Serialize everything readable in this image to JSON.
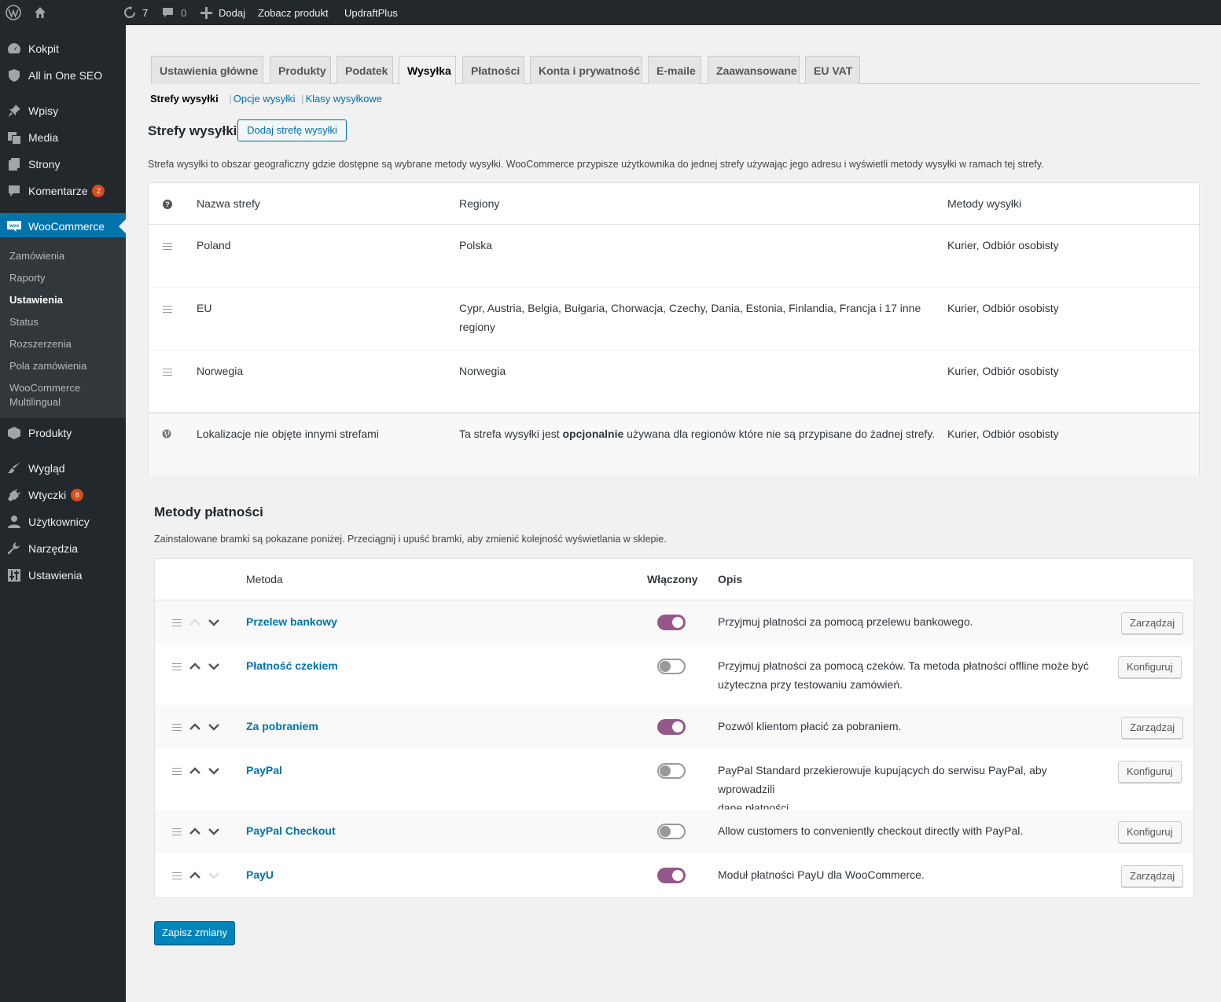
{
  "adminbar": {
    "updates_count": "7",
    "comments_count": "0",
    "new_label": "Dodaj",
    "view_product": "Zobacz produkt",
    "updraft": "UpdraftPlus"
  },
  "sidebar": {
    "dashboard": "Kokpit",
    "seo": "All in One SEO",
    "posts": "Wpisy",
    "media": "Media",
    "pages": "Strony",
    "comments": "Komentarze",
    "comments_badge": "2",
    "woocommerce": "WooCommerce",
    "submenu": [
      "Zamówienia",
      "Raporty",
      "Ustawienia",
      "Status",
      "Rozszerzenia",
      "Pola zamówienia",
      "WooCommerce Multilingual"
    ],
    "products": "Produkty",
    "appearance": "Wygląd",
    "plugins": "Wtyczki",
    "plugins_badge": "8",
    "users": "Użytkownicy",
    "tools": "Narzędzia",
    "settings": "Ustawienia"
  },
  "tabs": [
    "Ustawienia główne",
    "Produkty",
    "Podatek",
    "Wysyłka",
    "Płatności",
    "Konta i prywatność",
    "E-maile",
    "Zaawansowane",
    "EU VAT"
  ],
  "subnav": {
    "zones": "Strefy wysyłki",
    "sep": "|",
    "options": "Opcje wysyłki",
    "classes": "Klasy wysyłkowe"
  },
  "zones": {
    "title": "Strefy wysyłki",
    "add_button": "Dodaj strefę wysyłki",
    "description": "Strefa wysyłki to obszar geograficzny gdzie dostępne są wybrane metody wysyłki. WooCommerce przypisze użytkownika do jednej strefy używając jego adresu i wyświetli metody wysyłki w ramach tej strefy.",
    "headers": {
      "name": "Nazwa strefy",
      "regions": "Regiony",
      "methods": "Metody wysyłki"
    },
    "rows": [
      {
        "name": "Poland",
        "regions": "Polska",
        "methods": "Kurier, Odbiór osobisty"
      },
      {
        "name": "EU",
        "regions_line1": "Cypr, Austria, Belgia, Bułgaria, Chorwacja, Czechy, Dania, Estonia, Finlandia, Francja i 17 inne",
        "regions_line2": "regiony",
        "methods": "Kurier, Odbiór osobisty"
      },
      {
        "name": "Norwegia",
        "regions": "Norwegia",
        "methods": "Kurier, Odbiór osobisty"
      }
    ],
    "rest": {
      "name": "Lokalizacje nie objęte innymi strefami",
      "desc_before": "Ta strefa wysyłki jest ",
      "desc_bold": "opcjonalnie",
      "desc_after": " używana dla regionów które nie są przypisane do żadnej strefy.",
      "methods": "Kurier, Odbiór osobisty"
    }
  },
  "payments": {
    "title": "Metody płatności",
    "description": "Zainstalowane bramki są pokazane poniżej. Przeciągnij i upuść bramki, aby zmienić kolejność wyświetlania w sklepie.",
    "headers": {
      "method": "Metoda",
      "enabled": "Włączony",
      "desc": "Opis"
    },
    "rows": [
      {
        "name": "Przelew bankowy",
        "enabled": true,
        "desc1": "Przyjmuj płatności za pomocą przelewu bankowego.",
        "desc2": "",
        "button": "Zarządzaj"
      },
      {
        "name": "Płatność czekiem",
        "enabled": false,
        "desc1": "Przyjmuj płatności za pomocą czeków. Ta metoda płatności offline może być",
        "desc2": "użyteczna przy testowaniu zamówień.",
        "button": "Konfiguruj"
      },
      {
        "name": "Za pobraniem",
        "enabled": true,
        "desc1": "Pozwól klientom płacić za pobraniem.",
        "desc2": "",
        "button": "Zarządzaj"
      },
      {
        "name": "PayPal",
        "enabled": false,
        "desc1": "PayPal Standard przekierowuje kupujących do serwisu PayPal, aby wprowadzili",
        "desc2": "dane płatności.",
        "button": "Konfiguruj"
      },
      {
        "name": "PayPal Checkout",
        "enabled": false,
        "desc1": "Allow customers to conveniently checkout directly with PayPal.",
        "desc2": "",
        "button": "Konfiguruj"
      },
      {
        "name": "PayU",
        "enabled": true,
        "desc1": "Moduł płatności PayU dla WooCommerce.",
        "desc2": "",
        "button": "Zarządzaj"
      }
    ]
  },
  "save_button": "Zapisz zmiany"
}
